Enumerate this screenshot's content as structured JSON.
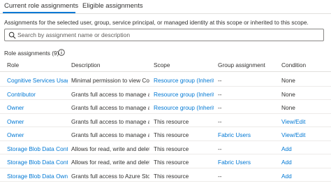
{
  "tabs": [
    {
      "label": "Current role assignments"
    },
    {
      "label": "Eligible assignments"
    }
  ],
  "description": "Assignments for the selected user, group, service principal, or managed identity at this scope or inherited to this scope.",
  "search": {
    "placeholder": "Search by assignment name or description",
    "value": ""
  },
  "count_label": "Role assignments (9)",
  "columns": {
    "role": "Role",
    "description": "Description",
    "scope": "Scope",
    "group": "Group assignment",
    "condition": "Condition"
  },
  "rows": [
    {
      "role": "Cognitive Services Usages Reader",
      "description": "Minimal permission to view Cognitive Services usages",
      "scope": "Resource group (Inherited)",
      "group": "--",
      "condition": "None"
    },
    {
      "role": "Contributor",
      "description": "Grants full access to manage all resources",
      "scope": "Resource group (Inherited)",
      "group": "--",
      "condition": "None"
    },
    {
      "role": "Owner",
      "description": "Grants full access to manage all resources",
      "scope": "Resource group (Inherited)",
      "group": "--",
      "condition": "None"
    },
    {
      "role": "Owner",
      "description": "Grants full access to manage all resources",
      "scope": "This resource",
      "group": "--",
      "condition": "View/Edit"
    },
    {
      "role": "Owner",
      "description": "Grants full access to manage all resources",
      "scope": "This resource",
      "group": "Fabric Users",
      "condition": "View/Edit"
    },
    {
      "role": "Storage Blob Data Contributor",
      "description": "Allows for read, write and delete access",
      "scope": "This resource",
      "group": "--",
      "condition": "Add"
    },
    {
      "role": "Storage Blob Data Contributor",
      "description": "Allows for read, write and delete access",
      "scope": "This resource",
      "group": "Fabric Users",
      "condition": "Add"
    },
    {
      "role": "Storage Blob Data Owner",
      "description": "Grants full access to Azure Storage blob containers",
      "scope": "This resource",
      "group": "--",
      "condition": "Add"
    }
  ],
  "colors": {
    "accent": "#0078d4",
    "text": "#323130",
    "border": "#e1dfdd"
  }
}
